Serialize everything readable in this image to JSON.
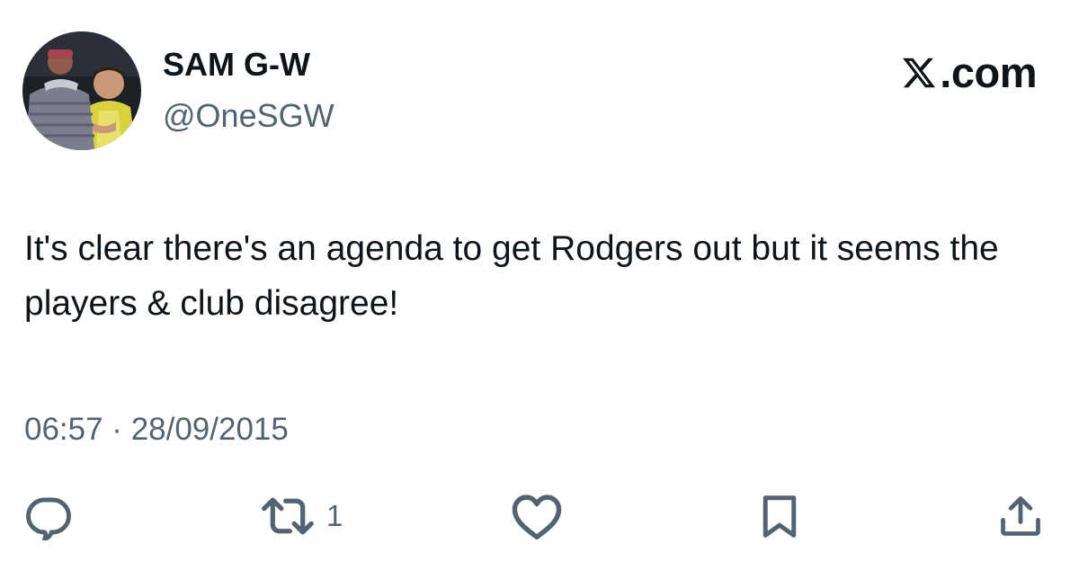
{
  "author": {
    "display_name": "SAM G-W",
    "handle": "@OneSGW",
    "avatar_icon": "profile-photo"
  },
  "brand": {
    "text": ".com",
    "icon": "x-logo-icon"
  },
  "tweet": {
    "text": "It's clear there's an agenda to get Rodgers out but it seems the players & club disagree!",
    "timestamp": "06:57 · 28/09/2015"
  },
  "actions": {
    "reply": {
      "icon": "reply-icon"
    },
    "retweet": {
      "icon": "retweet-icon",
      "count": "1"
    },
    "like": {
      "icon": "heart-icon"
    },
    "bookmark": {
      "icon": "bookmark-icon"
    },
    "share": {
      "icon": "share-icon"
    }
  },
  "colors": {
    "text_primary": "#0f1419",
    "text_secondary": "#536471",
    "icon": "#536471",
    "background": "#ffffff"
  }
}
